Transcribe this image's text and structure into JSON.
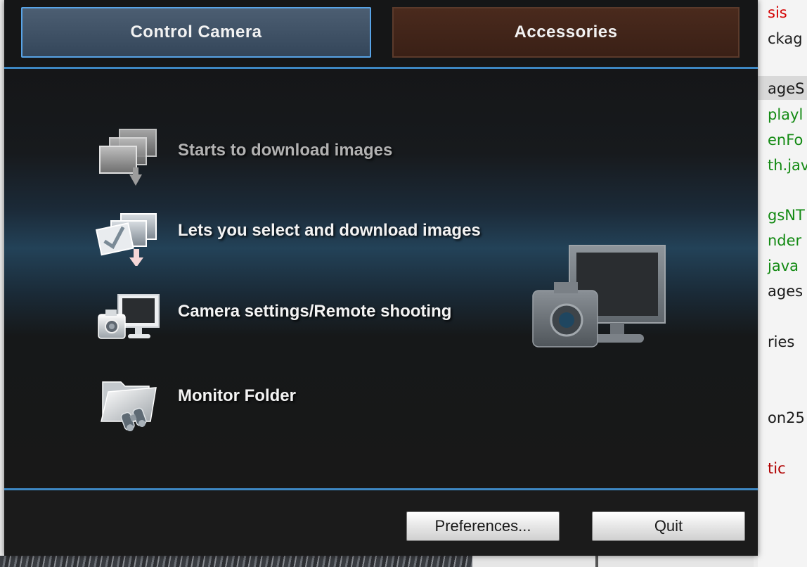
{
  "tabs": [
    {
      "label": "Control Camera",
      "selected": true
    },
    {
      "label": "Accessories",
      "selected": false
    }
  ],
  "menu": [
    {
      "label": "Starts to download images",
      "icon": "download-images-icon",
      "state": "disabled"
    },
    {
      "label": "Lets you select and download images",
      "icon": "select-download-icon",
      "state": "enabled"
    },
    {
      "label": "Camera settings/Remote shooting",
      "icon": "camera-monitor-icon",
      "state": "enabled"
    },
    {
      "label": "Monitor Folder",
      "icon": "folder-binoculars-icon",
      "state": "enabled"
    }
  ],
  "footer": {
    "preferences_label": "Preferences...",
    "quit_label": "Quit"
  },
  "background_editor": {
    "lines": [
      {
        "text": "sis",
        "color": "#d40000"
      },
      {
        "text": "ckag",
        "color": "#1a1a1a"
      },
      {
        "text": "ageS",
        "color": "#1a1a1a"
      },
      {
        "text": "playl",
        "color": "#138a13"
      },
      {
        "text": "enFo",
        "color": "#138a13"
      },
      {
        "text": "th.jav",
        "color": "#138a13"
      },
      {
        "text": "gsNT",
        "color": "#138a13"
      },
      {
        "text": "nder",
        "color": "#138a13"
      },
      {
        "text": "java",
        "color": "#138a13"
      },
      {
        "text": "ages",
        "color": "#1a1a1a"
      },
      {
        "text": "ries",
        "color": "#1a1a1a"
      },
      {
        "text": "on25",
        "color": "#1a1a1a"
      },
      {
        "text": "tic",
        "color": "#b00000"
      }
    ]
  },
  "colors": {
    "accent_blue": "#3d87c2",
    "tab_selected": "#4c5e72",
    "tab_other": "#4a2a1d"
  }
}
